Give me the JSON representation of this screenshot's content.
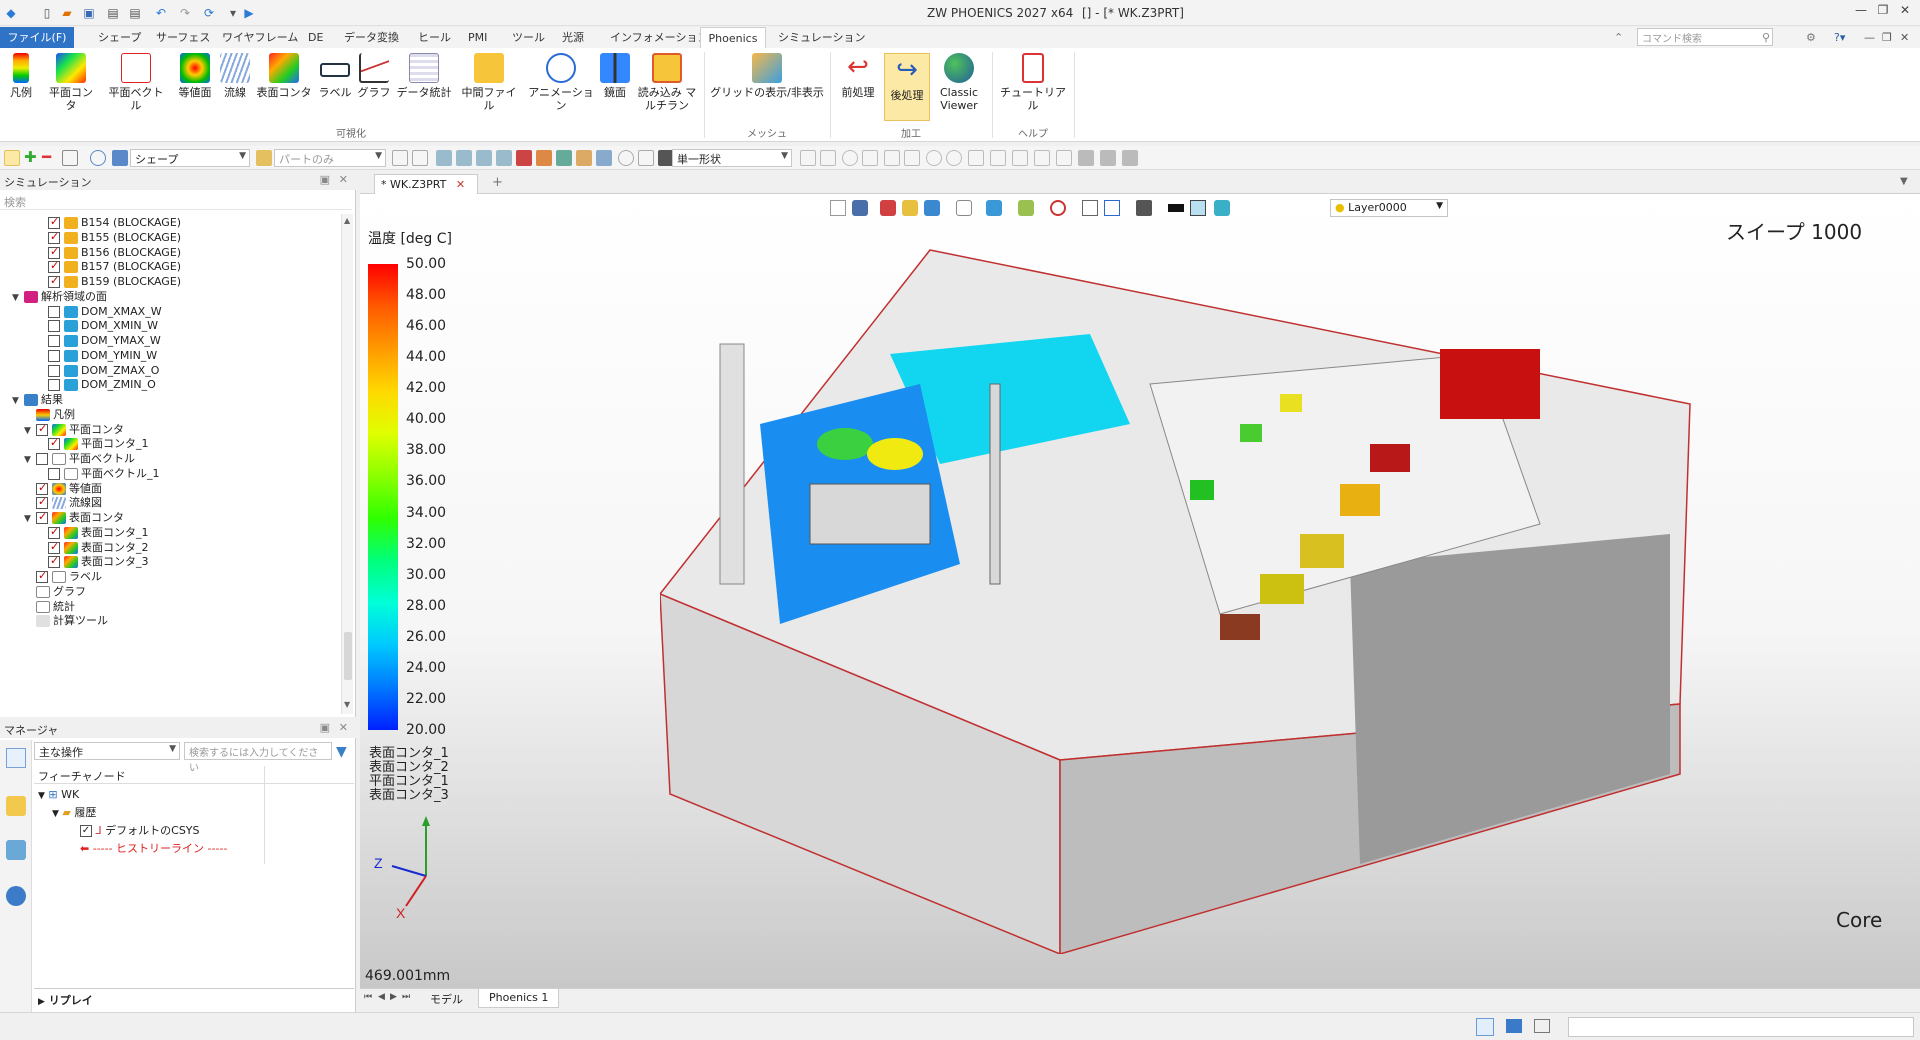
{
  "app": {
    "title": "ZW PHOENICS 2027 x64",
    "document": "[] - [* WK.Z3PRT]"
  },
  "menu": {
    "file": "ファイル(F)",
    "tabs": [
      "シェープ",
      "サーフェス",
      "ワイヤフレーム",
      "DE",
      "データ変換",
      "ヒール",
      "PMI",
      "ツール",
      "光源",
      "インフォメーション",
      "Phoenics",
      "シミュレーション"
    ],
    "active": "Phoenics",
    "search_placeholder": "コマンド検索"
  },
  "ribbon": {
    "buttons": [
      "凡例",
      "平面コンタ",
      "平面ベクトル",
      "等値面",
      "流線",
      "表面コンタ",
      "ラベル",
      "グラフ",
      "データ統計",
      "中間ファイル",
      "アニメーション",
      "鏡面",
      "読み込み マルチラン",
      "グリッドの表示/非表示",
      "前処理",
      "後処理",
      "Classic Viewer",
      "チュートリアル"
    ],
    "groups": [
      "可視化",
      "メッシュ",
      "加工",
      "ヘルプ"
    ]
  },
  "toolbar": {
    "filter": "シェープ",
    "pick": "パートのみ",
    "shape": "単一形状"
  },
  "sim": {
    "title": "シミュレーション",
    "search": "検索",
    "tree": [
      {
        "label": "B154 (BLOCKAGE)",
        "level": 3,
        "check": true,
        "icon": "blockage-icon"
      },
      {
        "label": "B155 (BLOCKAGE)",
        "level": 3,
        "check": true,
        "icon": "blockage-icon"
      },
      {
        "label": "B156 (BLOCKAGE)",
        "level": 3,
        "check": true,
        "icon": "blockage-icon"
      },
      {
        "label": "B157 (BLOCKAGE)",
        "level": 3,
        "check": true,
        "icon": "blockage-icon"
      },
      {
        "label": "B159 (BLOCKAGE)",
        "level": 3,
        "check": true,
        "icon": "blockage-icon"
      },
      {
        "label": "解析領域の面",
        "level": 1,
        "exp": "v",
        "icon": "domain-face-icon"
      },
      {
        "label": "DOM_XMAX_W",
        "level": 3,
        "check": false,
        "icon": "face-icon"
      },
      {
        "label": "DOM_XMIN_W",
        "level": 3,
        "check": false,
        "icon": "face-icon"
      },
      {
        "label": "DOM_YMAX_W",
        "level": 3,
        "check": false,
        "icon": "face-icon"
      },
      {
        "label": "DOM_YMIN_W",
        "level": 3,
        "check": false,
        "icon": "face-icon"
      },
      {
        "label": "DOM_ZMAX_O",
        "level": 3,
        "check": false,
        "icon": "face-icon"
      },
      {
        "label": "DOM_ZMIN_O",
        "level": 3,
        "check": false,
        "icon": "face-icon"
      },
      {
        "label": "結果",
        "level": 1,
        "exp": "v",
        "icon": "results-icon"
      },
      {
        "label": "凡例",
        "level": 2,
        "icon": "legend-icon"
      },
      {
        "label": "平面コンタ",
        "level": 2,
        "exp": "v",
        "check": true,
        "icon": "plane-contour-icon"
      },
      {
        "label": "平面コンタ_1",
        "level": 3,
        "check": true,
        "icon": "plane-contour-icon"
      },
      {
        "label": "平面ベクトル",
        "level": 2,
        "exp": "v",
        "check": false,
        "icon": "plane-vector-icon"
      },
      {
        "label": "平面ベクトル_1",
        "level": 3,
        "check": false,
        "icon": "plane-vector-icon"
      },
      {
        "label": "等値面",
        "level": 2,
        "check": true,
        "icon": "isosurface-icon"
      },
      {
        "label": "流線図",
        "level": 2,
        "check": true,
        "icon": "streamline-icon"
      },
      {
        "label": "表面コンタ",
        "level": 2,
        "exp": "v",
        "check": true,
        "icon": "surface-contour-icon"
      },
      {
        "label": "表面コンタ_1",
        "level": 3,
        "check": true,
        "icon": "surface-contour-icon"
      },
      {
        "label": "表面コンタ_2",
        "level": 3,
        "check": true,
        "icon": "surface-contour-icon"
      },
      {
        "label": "表面コンタ_3",
        "level": 3,
        "check": true,
        "icon": "surface-contour-icon"
      },
      {
        "label": "ラベル",
        "level": 2,
        "check": true,
        "icon": "label-icon"
      },
      {
        "label": "グラフ",
        "level": 2,
        "icon": "graph-icon"
      },
      {
        "label": "統計",
        "level": 2,
        "icon": "statistics-icon"
      },
      {
        "label": "計算ツール",
        "level": 2,
        "icon": "calc-tool-icon"
      }
    ]
  },
  "mgr": {
    "title": "マネージャ",
    "filter": "主な操作",
    "search_placeholder": "検索するには入力してください",
    "col": "フィーチャノード",
    "root": "WK",
    "history": "履歴",
    "csys": "デフォルトのCSYS",
    "histline": "----- ヒストリーライン -----",
    "replay": "リプレイ"
  },
  "view": {
    "doctab": "* WK.Z3PRT",
    "layer": "Layer0000",
    "legend_title": "温度 [deg C]",
    "legend_values": [
      "50.00",
      "48.00",
      "46.00",
      "44.00",
      "42.00",
      "40.00",
      "38.00",
      "36.00",
      "34.00",
      "32.00",
      "30.00",
      "28.00",
      "26.00",
      "24.00",
      "22.00",
      "20.00"
    ],
    "overlays": [
      "表面コンタ_1",
      "表面コンタ_2",
      "平面コンタ_1",
      "表面コンタ_3"
    ],
    "sweep": "スイープ 1000",
    "core": "Core",
    "scale": "469.001mm",
    "axis_z": "Z",
    "axis_x": "X"
  },
  "bottom": {
    "tabs": [
      "モデル",
      "Phoenics 1"
    ]
  }
}
